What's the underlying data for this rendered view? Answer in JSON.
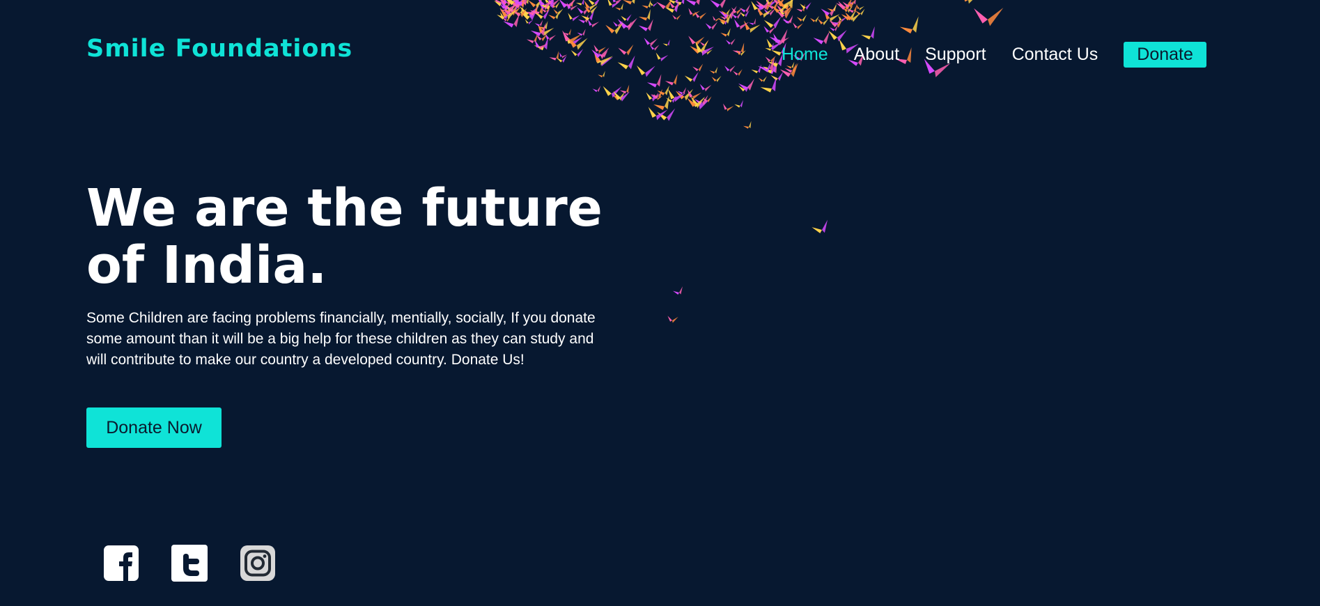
{
  "brand": {
    "name": "Smile Foundations",
    "accent_color": "#0fe3d7",
    "background_color": "#071830"
  },
  "nav": {
    "items": [
      {
        "label": "Home",
        "active": true
      },
      {
        "label": "About",
        "active": false
      },
      {
        "label": "Support",
        "active": false
      },
      {
        "label": "Contact Us",
        "active": false
      }
    ],
    "donate_label": "Donate"
  },
  "hero": {
    "title": "We are the future of India.",
    "text": "Some Children are facing problems financially, mentially, socially, If you donate some amount than it will be a big help for these children as they can study and will contribute to make our country a developed country. Donate Us!",
    "cta_label": "Donate Now"
  },
  "social": {
    "icons": [
      "facebook-icon",
      "twitter-icon",
      "instagram-icon"
    ]
  },
  "decoration": {
    "flock_icon": "flying-birds",
    "flock_colors": [
      "#ff5fb0",
      "#ff8a3d",
      "#ffd24a",
      "#d64aff"
    ]
  }
}
